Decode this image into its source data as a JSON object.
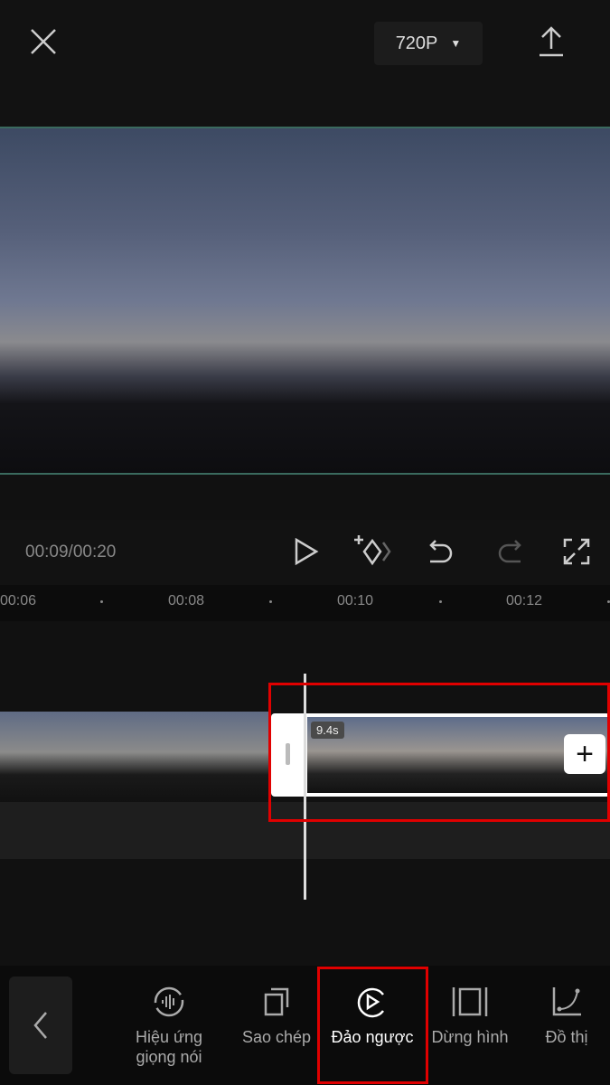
{
  "header": {
    "resolution": "720P"
  },
  "playback": {
    "time": "00:09/00:20"
  },
  "ruler": [
    "00:06",
    "00:08",
    "00:10",
    "00:12"
  ],
  "clip": {
    "duration": "9.4s"
  },
  "tools": [
    {
      "label": "Hiệu ứng",
      "label2": "giọng nói",
      "icon": "voice-effect-icon"
    },
    {
      "label": "Sao chép",
      "icon": "copy-icon"
    },
    {
      "label": "Đảo ngược",
      "icon": "reverse-icon"
    },
    {
      "label": "Dừng hình",
      "icon": "freeze-icon"
    },
    {
      "label": "Đồ thị",
      "icon": "curve-icon"
    }
  ],
  "colors": {
    "highlight": "#e00000"
  }
}
